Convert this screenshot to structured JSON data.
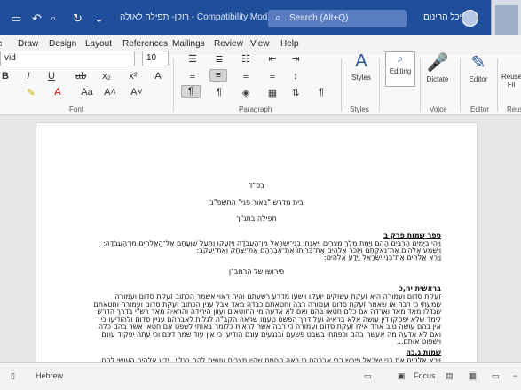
{
  "window": {
    "title": "רוקן- תפילה לאולה - Compatibility Mode - Word",
    "search_placeholder": "Search (Alt+Q)",
    "user_name": "מיכל הרינום"
  },
  "tabs": [
    "Draw",
    "Design",
    "Layout",
    "References",
    "Mailings",
    "Review",
    "View",
    "Help"
  ],
  "ribbon": {
    "font_name": "vid",
    "font_size": "10",
    "groups": {
      "font": "Font",
      "paragraph": "Paragraph",
      "styles": "Styles",
      "voice": "Voice",
      "editor": "Editor",
      "reuse": "Reuse"
    },
    "buttons": {
      "styles": "Styles",
      "editing": "Editing",
      "dictate": "Dictate",
      "editor": "Editor",
      "reuse_files_1": "Reuse",
      "reuse_files_2": "Fil"
    }
  },
  "document": {
    "lines": [
      "בס\"ד",
      "בית מדרש \"באור פני\" התשפ\"ב",
      "תפילה בתנ\"ך",
      "ספר שמות פרק ב",
      "וַיְהִי בַיָּמִים הָרַבִּים הָהֵם וַיָּמָת מֶלֶךְ מִצְרַיִם וַיֵּאָנְחוּ בְנֵי־יִשְׂרָאֵל מִן־הָעֲבֹדָה וַיִּזְעָקוּ וַתַּעַל שַׁוְעָתָם אֶל־הָאֱלֹהִים מִן־הָעֲבֹדָה:",
      "וַיִּשְׁמַע אֱלֹהִים אֶת־נַאֲקָתָם וַיִּזְכֹּר אֱלֹהִים אֶת־בְּרִיתוֹ אֶת־אַבְרָהָם אֶת־יִצְחָק וְאֶת־יַעֲקֹב:",
      "וַיַּרְא אֱלֹהִים אֶת־בְּנֵי יִשְׂרָאֵל וַיֵּדַע אֱלֹהִים:",
      "פירושו של הרמב\"ן",
      "בראשית יח,כ",
      "זעקת סדום ועמורה היא זעקת עשוקים יועקו וישעו מדרע רשעתם והיה ראוי אשמר הכתוב זעקת סדום ועמורה",
      "שמעתי כי רבה או שאמר זעקת סדום ועמורה רבה וחטאתם כבדה מאד אבל ענין הכתוב זעקת סדום ועמורה וחטאתם",
      "שגדלו מאד מאד וארדה אם כלם חטאו בהם ואם לא אדעה מי החוטאים ועוון הירידה והראיה מאד רש\"י בדרך הדרש",
      "לימד שלא יפסקו דין עושה אלא בראיה ועל דרך הפשט טעמו שראה הקב\"ה לגלות לאברהם עניין סדום ולהודיעו כי",
      "אין בהם עושה טוב אחד אילו זעקת סדום ועמורה כי רבה אשר לראות כלומר באותי לשפט אם חטאו אשר בהם כלה",
      "ואם לא אדעה מה אעשה בהם וכפתחי בשבט פשעם ובנגעים עונם הודיעו כי אין עוד שמר דינם וכי עתה יפקוד עונם",
      "וישפוט אותם...",
      "שמות ג,כה",
      "וירא אלהים את בני ישראל פירש רבי אברהם כי ראה החמס שהיו מצרים עושים להם בגלוי, וידע אלהים העושי להם"
    ]
  },
  "status": {
    "language": "Hebrew",
    "focus": "Focus"
  }
}
